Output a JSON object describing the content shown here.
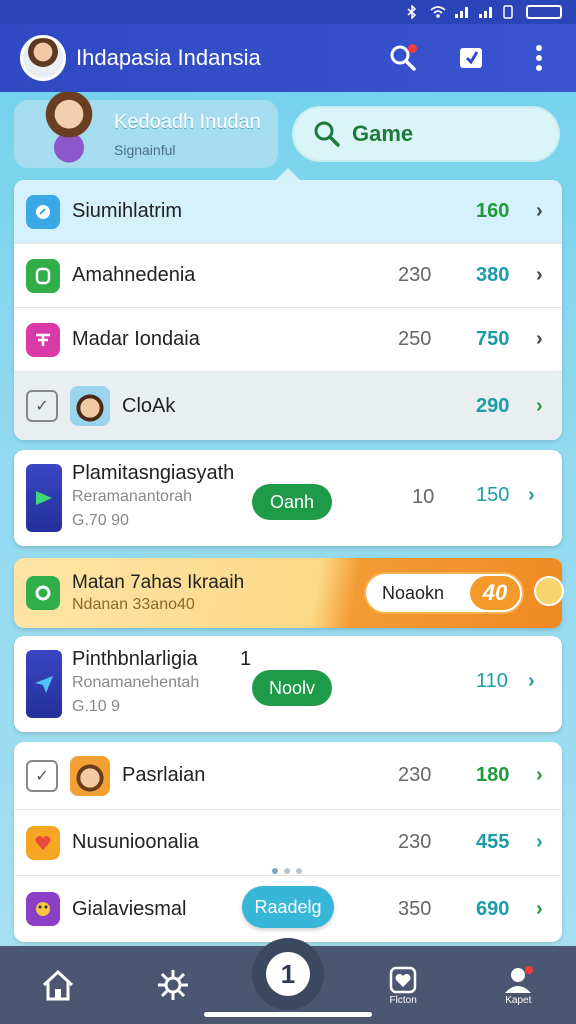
{
  "app_bar": {
    "title": "Ihdapasia Indansia"
  },
  "profile": {
    "name": "Kedoadh Inudan",
    "subtitle": "Signainful"
  },
  "game_button": {
    "label": "Game"
  },
  "list_top": [
    {
      "name": "Siumihlatrim",
      "count": "",
      "score": "160",
      "score_color": "green",
      "chevron": "›"
    },
    {
      "name": "Amahnedenia",
      "count": "230",
      "score": "380",
      "score_color": "teal",
      "chevron": "›"
    },
    {
      "name": "Madar Iondaia",
      "count": "250",
      "score": "750",
      "score_color": "teal",
      "chevron": "›"
    },
    {
      "name": "CloAk",
      "count": "",
      "score": "290",
      "score_color": "teal",
      "chevron": "›"
    }
  ],
  "featured_1": {
    "title": "Plamitasngiasyath",
    "subtitle": "Reramanantorah",
    "line3": "G.70 90",
    "pill": "Oanh",
    "count": "10",
    "score": "150",
    "chevron": "›"
  },
  "promo": {
    "title": "Matan 7ahas Ikraaih",
    "subtitle": "Ndanan 33ano40",
    "pill": "Noaokn",
    "badge": "40"
  },
  "featured_2": {
    "title": "Pinthbnlarligia",
    "title_suffix": "1",
    "subtitle": "Ronamanehentah",
    "line3": "G.10 9",
    "pill": "Noolv",
    "count": "",
    "score": "110",
    "chevron": "›"
  },
  "list_bottom": [
    {
      "name": "Pasrlaian",
      "count": "230",
      "score": "180",
      "score_color": "green",
      "chevron": "›"
    },
    {
      "name": "Nusunioonalia",
      "count": "230",
      "score": "455",
      "score_color": "teal",
      "chevron": "›"
    },
    {
      "name": "Gialaviesmal",
      "count": "350",
      "score": "690",
      "score_color": "teal",
      "chevron": "›"
    }
  ],
  "random_pill": {
    "label": "Raadelg"
  },
  "bottom_nav": {
    "center_label": "1",
    "item4_label": "Flcton",
    "item5_label": "Kapet"
  },
  "colors": {
    "app_bar": "#2f49c2",
    "accent_green": "#1f9a3a",
    "accent_teal": "#1a9da6",
    "promo_orange": "#f39a2b"
  }
}
